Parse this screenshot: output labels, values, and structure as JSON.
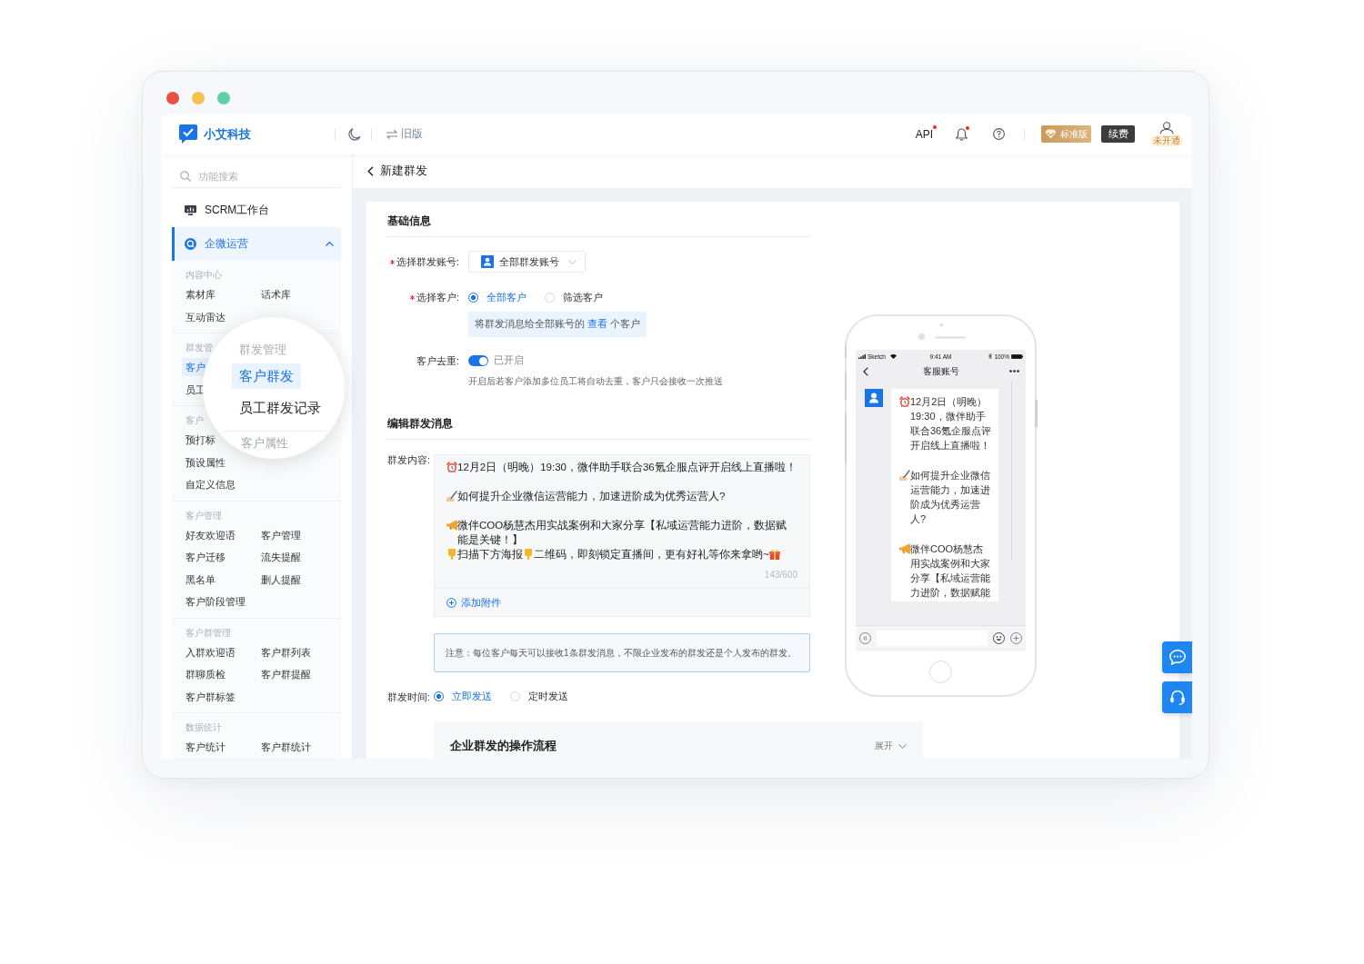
{
  "header": {
    "brand": "小艾科技",
    "old_version": "旧版",
    "api": {
      "label": "API",
      "dot": true
    },
    "bell": {
      "dot": true
    },
    "plan": "标准版",
    "renew": "续费",
    "account_status": "未开通"
  },
  "sidebar": {
    "search": {
      "placeholder": "功能搜索"
    },
    "items": [
      {
        "label": "SCRM工作台",
        "kind": "workbench",
        "selected": false
      },
      {
        "label": "企微运营",
        "kind": "operations",
        "selected": true,
        "expanded": true,
        "sections": [
          {
            "title": "内容中心",
            "rows": [
              [
                {
                  "label": "素材库",
                  "selected": false
                },
                {
                  "label": "话术库",
                  "selected": false
                }
              ],
              [
                {
                  "label": "互动雷达",
                  "selected": false
                }
              ]
            ]
          },
          {
            "title": "群发管",
            "rows": [
              [
                {
                  "label": "客户",
                  "selected": true
                }
              ],
              [
                {
                  "label": "员工",
                  "selected": false
                }
              ]
            ]
          },
          {
            "title": "客户",
            "rows": [
              [
                {
                  "label": "预打标",
                  "selected": false
                }
              ],
              [
                {
                  "label": "预设属性",
                  "selected": false
                }
              ],
              [
                {
                  "label": "自定义信息",
                  "selected": false
                }
              ]
            ]
          },
          {
            "title": "客户管理",
            "rows": [
              [
                {
                  "label": "好友欢迎语",
                  "selected": false
                },
                {
                  "label": "客户管理",
                  "selected": false
                }
              ],
              [
                {
                  "label": "客户迁移",
                  "selected": false
                },
                {
                  "label": "流失提醒",
                  "selected": false
                }
              ],
              [
                {
                  "label": "黑名单",
                  "selected": false
                },
                {
                  "label": "删人提醒",
                  "selected": false
                }
              ],
              [
                {
                  "label": "客户阶段管理",
                  "selected": false
                }
              ]
            ]
          },
          {
            "title": "客户群管理",
            "rows": [
              [
                {
                  "label": "入群欢迎语",
                  "selected": false
                },
                {
                  "label": "客户群列表",
                  "selected": false
                }
              ],
              [
                {
                  "label": "群聊质检",
                  "selected": false
                },
                {
                  "label": "客户群提醒",
                  "selected": false
                }
              ],
              [
                {
                  "label": "客户群标签",
                  "selected": false
                }
              ]
            ]
          },
          {
            "title": "数据统计",
            "rows": [
              [
                {
                  "label": "客户统计",
                  "selected": false
                },
                {
                  "label": "客户群统计",
                  "selected": false
                }
              ]
            ]
          }
        ]
      }
    ]
  },
  "magnifier": {
    "title": "群发管理",
    "items": [
      {
        "label": "客户群发",
        "selected": true
      },
      {
        "label": "员工群发记录",
        "selected": false
      }
    ],
    "next_title": "客户属性"
  },
  "page": {
    "title": "新建群发"
  },
  "basic_info": {
    "title": "基础信息",
    "account": {
      "label": "选择群发账号:",
      "required": true,
      "value": "全部群发账号"
    },
    "customers": {
      "label": "选择客户:",
      "required": true,
      "options": [
        {
          "label": "全部客户",
          "selected": true
        },
        {
          "label": "筛选客户",
          "selected": false
        }
      ],
      "info": {
        "text_before": "将群发消息给全部账号的",
        "link": "查看",
        "text_after": "个客户"
      }
    },
    "dedupe": {
      "label": "客户去重:",
      "required": false,
      "on": true,
      "status": "已开启",
      "hint": "开启后若客户添加多位员工将自动去重，客户只会接收一次推送"
    }
  },
  "message": {
    "title": "编辑群发消息",
    "content_label": "群发内容:",
    "blocks": [
      [
        [
          {
            "kind": "clock"
          },
          {
            "kind": "text",
            "text": "12月2日（明晚）19:30，微伴助手联合36氪企服点评开启线上直播啦！"
          }
        ]
      ],
      [
        [
          {
            "kind": "pen"
          },
          {
            "kind": "text",
            "text": "如何提升企业微信运营能力，加速进阶成为优秀运营人?"
          }
        ]
      ],
      [
        [
          {
            "kind": "horn"
          },
          {
            "kind": "text",
            "text": "微伴COO杨慧杰用实战案例和大家分享【私域运营能力进阶，数据赋能是关键！】"
          }
        ],
        [
          {
            "kind": "hand"
          },
          {
            "kind": "text",
            "text": "扫描下方海报"
          },
          {
            "kind": "hand"
          },
          {
            "kind": "text",
            "text": "二维码，即刻锁定直播间，更有好礼等你来拿哟~"
          },
          {
            "kind": "gift"
          }
        ]
      ]
    ],
    "counter": "143/600",
    "attach": "添加附件",
    "notice": "注意：每位客户每天可以接收1条群发消息，不限企业发布的群发还是个人发布的群发。",
    "time_label": "群发时间:",
    "time_options": [
      {
        "label": "立即发送",
        "selected": true
      },
      {
        "label": "定时发送",
        "selected": false
      }
    ],
    "guide": {
      "title": "企业群发的操作流程",
      "toggle": "展开",
      "expanded": false
    }
  },
  "preview": {
    "status_bar": {
      "carrier": "Sketch",
      "time": "9:41 AM",
      "battery": "100%"
    },
    "title": "客服账号",
    "blocks": [
      [
        [
          {
            "kind": "clock"
          },
          {
            "kind": "text",
            "text": "12月2日（明晚）19:30，微伴助手联合36氪企服点评开启线上直播啦！"
          }
        ]
      ],
      [
        [
          {
            "kind": "pen"
          },
          {
            "kind": "text",
            "text": "如何提升企业微信运营能力，加速进阶成为优秀运营人?"
          }
        ]
      ],
      [
        [
          {
            "kind": "horn"
          },
          {
            "kind": "text",
            "text": "微伴COO杨慧杰用实战案例和大家分享【私域运营能力进阶，数据赋能"
          }
        ]
      ]
    ]
  }
}
